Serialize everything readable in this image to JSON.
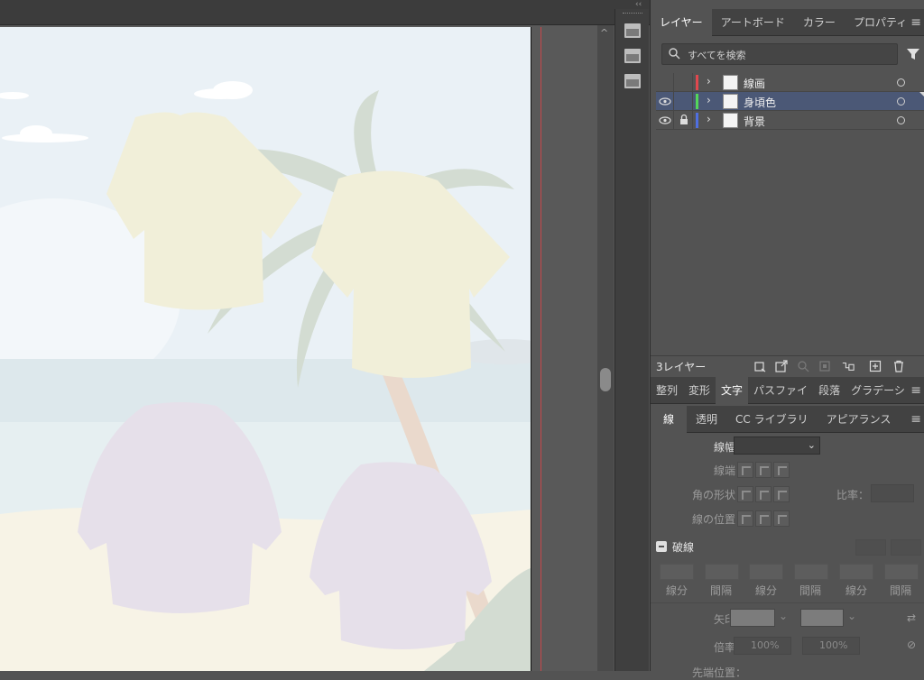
{
  "canvas": {
    "colors": {
      "sky": "#eaf1f6",
      "sea": "#d9e5ea",
      "sand": "#f7f3e6",
      "shirt_yellow": "#f1efd9",
      "shirt_purple": "#e6e0ea",
      "palm": "#d3dcd2",
      "trunk": "#ead9cc",
      "artboard_edge": "#111111",
      "bleed_line": "#c8474b"
    }
  },
  "layers_panel": {
    "tabs": [
      "レイヤー",
      "アートボード",
      "カラー",
      "プロパティ"
    ],
    "active_tab": "レイヤー",
    "search_placeholder": "すべてを検索",
    "layers": [
      {
        "name": "線画",
        "color": "#e0484e",
        "visible": false,
        "locked": false
      },
      {
        "name": "身頃色",
        "color": "#54d65a",
        "visible": true,
        "locked": false,
        "selected": true
      },
      {
        "name": "背景",
        "color": "#4f6fe0",
        "visible": true,
        "locked": true
      }
    ],
    "layer_count": "3レイヤー",
    "footer_icons": [
      "artboard-collect-icon",
      "export-icon",
      "locate-icon",
      "clip-mask-icon",
      "new-sublayer-icon",
      "new-layer-icon",
      "trash-icon"
    ]
  },
  "bottom_panel": {
    "tabs": [
      "整列",
      "変形",
      "文字",
      "パスファイ",
      "段落",
      "グラデーシ"
    ],
    "active_tab": "文字"
  },
  "stroke_panel": {
    "tabs": [
      "線",
      "透明",
      "CC ライブラリ",
      "アピアランス"
    ],
    "active_tab": "線",
    "weight_label": "線幅：",
    "weight_value": "",
    "cap_label": "線端：",
    "corner_label": "角の形状：",
    "limit_label": "比率：",
    "align_label": "線の位置：",
    "dashed_label": "破線",
    "dash_labels": [
      "線分",
      "間隔",
      "線分",
      "間隔",
      "線分",
      "間隔"
    ],
    "arrow_label": "矢印：",
    "scale_label": "倍率：",
    "scale_values": [
      "100%",
      "100%"
    ],
    "align_label_2": "先端位置："
  }
}
